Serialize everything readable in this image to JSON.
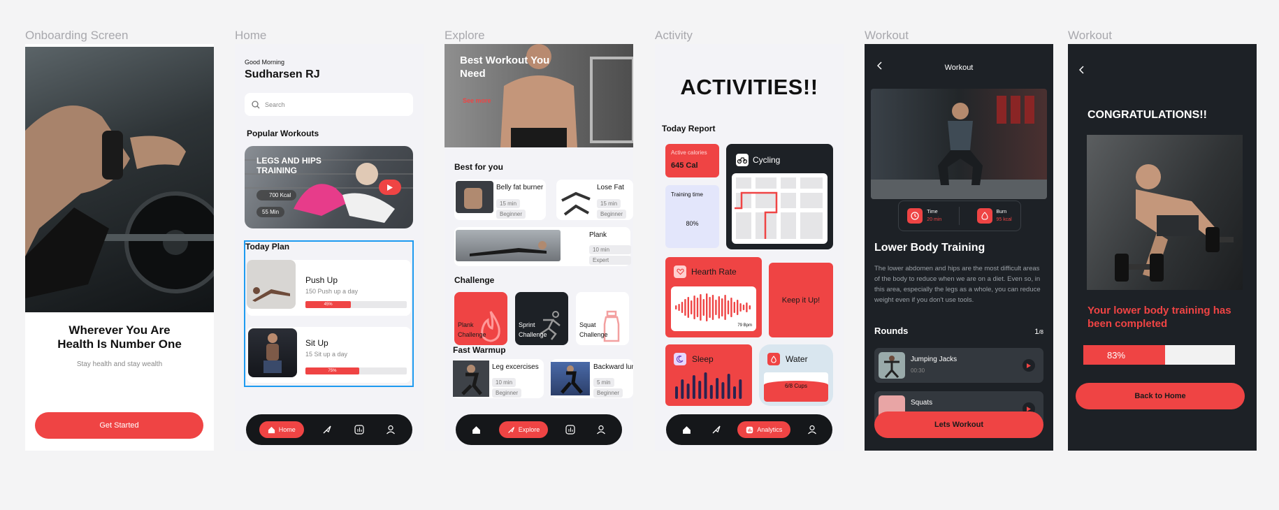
{
  "frames": {
    "onboarding": "Onboarding Screen",
    "home": "Home",
    "explore": "Explore",
    "activity": "Activity",
    "workout1": "Workout",
    "workout2": "Workout"
  },
  "onboarding": {
    "headline_line1": "Wherever You Are",
    "headline_line2": "Health Is Number One",
    "subtitle": "Stay health and stay wealth",
    "cta": "Get Started"
  },
  "home": {
    "greeting": "Good Morning",
    "user": "Sudharsen RJ",
    "search_placeholder": "Search",
    "popular_title": "Popular Workouts",
    "popular_card": {
      "title_line1": "LEGS AND HIPS",
      "title_line2": "TRAINING",
      "kcal": "700 Kcal",
      "duration": "55 Min"
    },
    "today_title": "Today Plan",
    "plans": [
      {
        "title": "Push Up",
        "desc": "150 Push up a day",
        "progress": 45,
        "progress_label": "45%"
      },
      {
        "title": "Sit Up",
        "desc": "15 Sit up a day",
        "progress": 75,
        "progress_label": "75%"
      }
    ],
    "nav_active": "Home"
  },
  "explore": {
    "hero_title_line1": "Best  Workout You",
    "hero_title_line2": "Need",
    "see_more": "See more",
    "best_title": "Best for you",
    "best": [
      {
        "title": "Belly fat burner",
        "time": "15 min",
        "level": "Beginner"
      },
      {
        "title": "Lose Fat",
        "time": "15 min",
        "level": "Beginner"
      },
      {
        "title": "Plank",
        "time": "10 min",
        "level": "Expert"
      }
    ],
    "challenge_title": "Challenge",
    "challenges": [
      {
        "line1": "Plank",
        "line2": "Challenge"
      },
      {
        "line1": "Sprint",
        "line2": "Challenge"
      },
      {
        "line1": "Squat",
        "line2": "Challenge"
      }
    ],
    "warmup_title": "Fast Warmup",
    "warmups": [
      {
        "title": "Leg excercises",
        "time": "10 min",
        "level": "Beginner"
      },
      {
        "title": "Backward lunge",
        "time": "5 min",
        "level": "Beginner"
      }
    ],
    "nav_active": "Explore"
  },
  "activity": {
    "title": "ACTIVITIES!!",
    "report_title": "Today Report",
    "calories_label": "Active calories",
    "calories_value": "645 Cal",
    "training_label": "Training time",
    "training_value": "80%",
    "cycling": "Cycling",
    "heart_rate": "Hearth Rate",
    "bpm": "79 Bpm",
    "keep": "Keep it Up!",
    "sleep": "Sleep",
    "water": "Water",
    "water_value": "6/8 Cups",
    "nav_active": "Analytics"
  },
  "workout": {
    "header": "Workout",
    "time_label": "Time",
    "time_value": "20 min",
    "burn_label": "Burn",
    "burn_value": "95 kcal",
    "title": "Lower Body Training",
    "description": "The lower abdomen and hips are the most difficult areas of the body to reduce when we are on a diet. Even so, in this area, especially the legs as a whole, you can reduce weight even if you don't use tools.",
    "rounds_label": "Rounds",
    "rounds_current": "1",
    "rounds_total": "/8",
    "rounds": [
      {
        "title": "Jumping Jacks",
        "time": "00:30"
      },
      {
        "title": "Squats",
        "time": ""
      }
    ],
    "cta": "Lets Workout"
  },
  "congrats": {
    "title": "CONGRATULATIONS!!",
    "message_line1": "Your lower body training has",
    "message_line2": "been completed",
    "progress": 83,
    "progress_label": "83%",
    "cta": "Back to Home"
  },
  "colors": {
    "accent": "#ef4444",
    "dark": "#1d2126",
    "selection": "#1e9bf0"
  }
}
